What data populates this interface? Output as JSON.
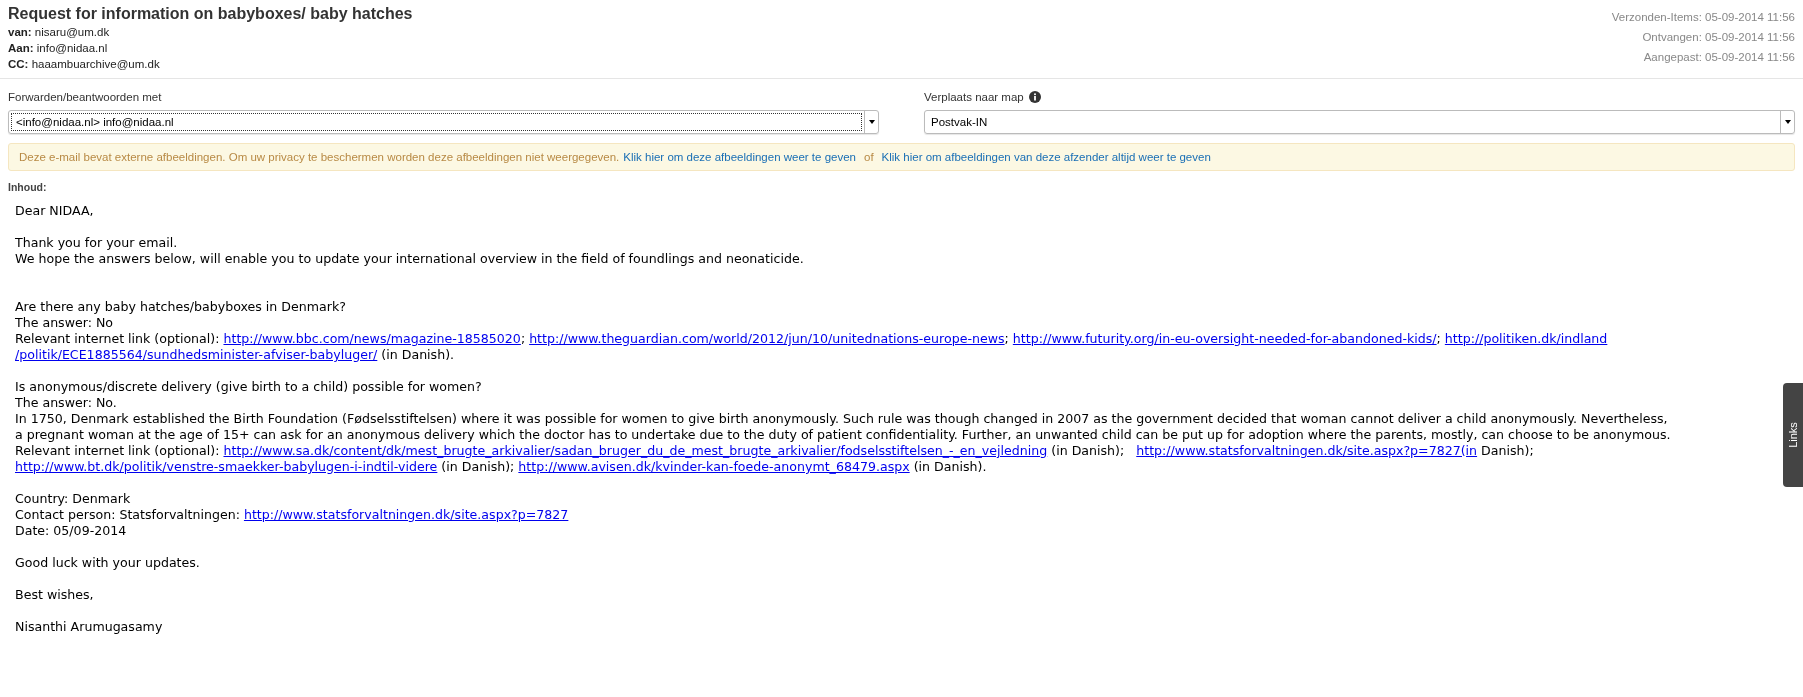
{
  "message": {
    "subject": "Request for information on babyboxes/ baby hatches",
    "headers": [
      {
        "label": "van:",
        "value": "nisaru@um.dk"
      },
      {
        "label": "Aan:",
        "value": "info@nidaa.nl"
      },
      {
        "label": "CC:",
        "value": "haaambuarchive@um.dk"
      }
    ],
    "meta": [
      "Verzonden-Items: 05-09-2014 11:56",
      "Ontvangen: 05-09-2014 11:56",
      "Aangepast: 05-09-2014 11:56"
    ]
  },
  "forward": {
    "label": "Forwarden/beantwoorden met",
    "value": "<info@nidaa.nl> info@nidaa.nl"
  },
  "move_to_folder": {
    "label": "Verplaats naar map",
    "value": "Postvak-IN"
  },
  "notice": {
    "text": "Deze e-mail bevat externe afbeeldingen. Om uw privacy te beschermen worden deze afbeeldingen niet weergegeven.",
    "links": [
      "Klik hier om deze afbeeldingen weer te geven",
      "Klik hier om afbeeldingen van deze afzender altijd weer te geven"
    ],
    "separator": "of"
  },
  "content_label": "Inhoud:",
  "body": [
    {
      "lines": [
        [
          {
            "kind": "text",
            "text": "Dear NIDAA,"
          }
        ]
      ]
    },
    {
      "lines": [
        [
          {
            "kind": "text",
            "text": "Thank you for your email."
          }
        ],
        [
          {
            "kind": "text",
            "text": "We hope the answers below, will enable you to update your international overview in the field of foundlings and neonaticide."
          }
        ]
      ]
    },
    {
      "lines": [
        [
          {
            "kind": "text",
            "text": "Are there any baby hatches/babyboxes in Denmark?"
          }
        ],
        [
          {
            "kind": "text",
            "text": "The answer: No"
          }
        ],
        [
          {
            "kind": "text",
            "text": "Relevant internet link (optional): "
          },
          {
            "kind": "link",
            "text": "http://www.bbc.com/news/magazine-18585020"
          },
          {
            "kind": "text",
            "text": "; "
          },
          {
            "kind": "link",
            "text": "http://www.theguardian.com/world/2012/jun/10/unitednations-europe-news"
          },
          {
            "kind": "text",
            "text": "; "
          },
          {
            "kind": "link",
            "text": "http://www.futurity.org/in-eu-oversight-needed-for-abandoned-kids/"
          },
          {
            "kind": "text",
            "text": "; "
          },
          {
            "kind": "link",
            "text": "http://politiken.dk/indland"
          }
        ],
        [
          {
            "kind": "link",
            "text": "/politik/ECE1885564/sundhedsminister-afviser-babyluger/"
          },
          {
            "kind": "text",
            "text": " (in Danish)."
          }
        ]
      ]
    },
    {
      "lines": [
        [
          {
            "kind": "text",
            "text": "Is anonymous/discrete delivery (give birth to a child) possible for women?"
          }
        ],
        [
          {
            "kind": "text",
            "text": "The answer: No."
          }
        ],
        [
          {
            "kind": "text",
            "text": "In 1750, Denmark established the Birth Foundation (Fødselsstiftelsen) where it was possible for women to give birth anonymously. Such rule was though changed in 2007 as the government decided that woman cannot deliver a child anonymously. Nevertheless,"
          }
        ],
        [
          {
            "kind": "text",
            "text": "a pregnant woman at the age of 15+ can ask for an anonymous delivery which the doctor has to undertake due to the duty of patient confidentiality. Further, an unwanted child can be put up for adoption where the parents, mostly, can choose to be anonymous."
          }
        ],
        [
          {
            "kind": "text",
            "text": "Relevant internet link (optional): "
          },
          {
            "kind": "link",
            "text": "http://www.sa.dk/content/dk/mest_brugte_arkivalier/sadan_bruger_du_de_mest_brugte_arkivalier/fodselsstiftelsen_-_en_vejledning"
          },
          {
            "kind": "text",
            "text": " (in Danish);   "
          },
          {
            "kind": "link",
            "text": "http://www.statsforvaltningen.dk/site.aspx?p=7827(in"
          },
          {
            "kind": "text",
            "text": " Danish);"
          }
        ],
        [
          {
            "kind": "link",
            "text": "http://www.bt.dk/politik/venstre-smaekker-babylugen-i-indtil-videre"
          },
          {
            "kind": "text",
            "text": " (in Danish); "
          },
          {
            "kind": "link",
            "text": "http://www.avisen.dk/kvinder-kan-foede-anonymt_68479.aspx"
          },
          {
            "kind": "text",
            "text": " (in Danish)."
          }
        ]
      ]
    },
    {
      "lines": [
        [
          {
            "kind": "text",
            "text": "Country: Denmark"
          }
        ],
        [
          {
            "kind": "text",
            "text": "Contact person: Statsforvaltningen: "
          },
          {
            "kind": "link",
            "text": "http://www.statsforvaltningen.dk/site.aspx?p=7827"
          }
        ],
        [
          {
            "kind": "text",
            "text": "Date: 05/09-2014"
          }
        ]
      ]
    },
    {
      "lines": [
        [
          {
            "kind": "text",
            "text": "Good luck with your updates."
          }
        ]
      ]
    },
    {
      "lines": [
        [
          {
            "kind": "text",
            "text": "Best wishes,"
          }
        ]
      ]
    },
    {
      "lines": [
        [
          {
            "kind": "text",
            "text": "Nisanthi Arumugasamy"
          }
        ]
      ]
    }
  ],
  "side_tab": "Links"
}
